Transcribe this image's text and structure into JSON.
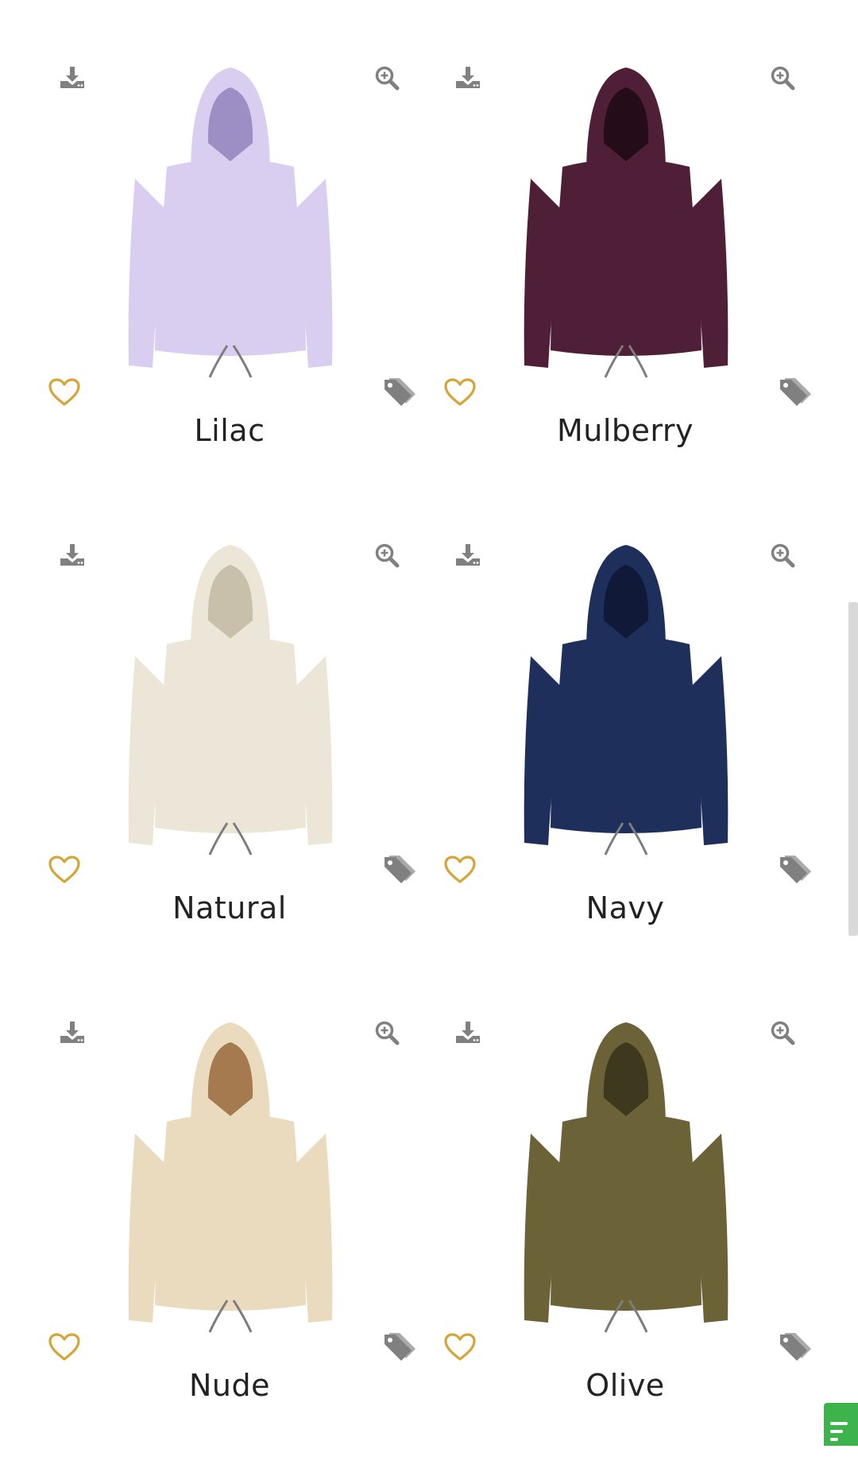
{
  "products": [
    {
      "name": "Lilac",
      "color": "#d9cdf0",
      "shade": "#9d8fc4"
    },
    {
      "name": "Mulberry",
      "color": "#4f1f38",
      "shade": "#240c18"
    },
    {
      "name": "Natural",
      "color": "#ece6d8",
      "shade": "#c9c0ac"
    },
    {
      "name": "Navy",
      "color": "#1f2f5c",
      "shade": "#101a38"
    },
    {
      "name": "Nude",
      "color": "#ebdbbe",
      "shade": "#a47a4e"
    },
    {
      "name": "Olive",
      "color": "#6c6238",
      "shade": "#3e381e"
    }
  ],
  "icons": {
    "download": "download-icon",
    "zoom": "zoom-in-icon",
    "favorite": "heart-outline-icon",
    "tags": "tags-icon"
  },
  "colors": {
    "icon_gray": "#808080",
    "heart_gold": "#d4a537",
    "chat_green": "#3cb44b"
  }
}
